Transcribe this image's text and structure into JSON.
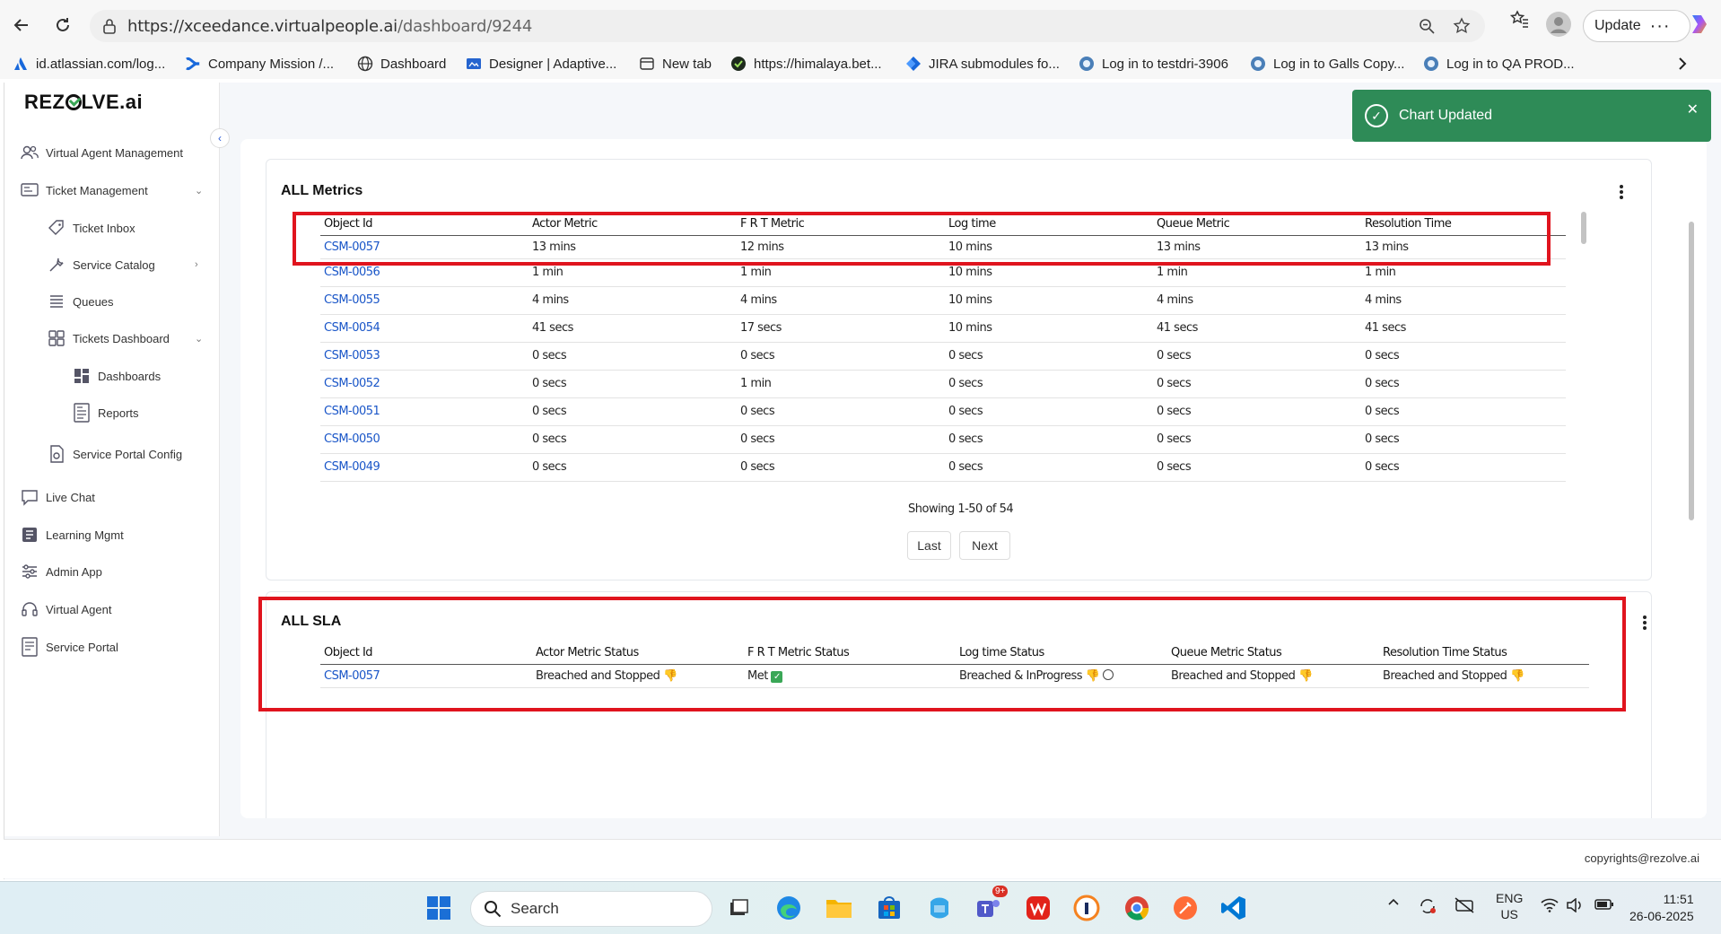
{
  "browser": {
    "url_main": "https://xceedance.virtualpeople.ai",
    "url_path": "/dashboard/9244",
    "update_label": "Update",
    "bookmarks": [
      {
        "label": "id.atlassian.com/log...",
        "icon": "atlassian-icon"
      },
      {
        "label": "Company Mission /...",
        "icon": "confluence-icon"
      },
      {
        "label": "Dashboard",
        "icon": "globe-icon"
      },
      {
        "label": "Designer | Adaptive...",
        "icon": "designer-icon"
      },
      {
        "label": "New tab",
        "icon": "newtab-icon"
      },
      {
        "label": "https://himalaya.bet...",
        "icon": "check-icon"
      },
      {
        "label": "JIRA submodules fo...",
        "icon": "jira-icon"
      },
      {
        "label": "Log in to testdri-3906",
        "icon": "login-icon"
      },
      {
        "label": "Log in to Galls Copy...",
        "icon": "login-icon"
      },
      {
        "label": "Log in to QA PROD...",
        "icon": "login-icon"
      }
    ]
  },
  "sidebar": {
    "logo_pre": "REZ",
    "logo_post": "LVE.ai",
    "items": {
      "virtual_agent_management": "Virtual Agent Management",
      "ticket_management": "Ticket Management",
      "ticket_inbox": "Ticket Inbox",
      "service_catalog": "Service Catalog",
      "queues": "Queues",
      "tickets_dashboard": "Tickets Dashboard",
      "dashboards": "Dashboards",
      "reports": "Reports",
      "service_portal_config": "Service Portal Config",
      "live_chat": "Live Chat",
      "learning_mgmt": "Learning Mgmt",
      "admin_app": "Admin App",
      "virtual_agent": "Virtual Agent",
      "service_portal": "Service Portal"
    }
  },
  "toast": {
    "message": "Chart Updated",
    "close": "✕"
  },
  "metrics": {
    "title": "ALL Metrics",
    "columns": [
      "Object Id",
      "Actor Metric",
      "F R T Metric",
      "Log time",
      "Queue Metric",
      "Resolution Time"
    ],
    "rows": [
      [
        "CSM-0057",
        "13 mins",
        "12 mins",
        "10 mins",
        "13 mins",
        "13 mins"
      ],
      [
        "CSM-0056",
        "1 min",
        "1 min",
        "10 mins",
        "1 min",
        "1 min"
      ],
      [
        "CSM-0055",
        "4 mins",
        "4 mins",
        "10 mins",
        "4 mins",
        "4 mins"
      ],
      [
        "CSM-0054",
        "41 secs",
        "17 secs",
        "10 mins",
        "41 secs",
        "41 secs"
      ],
      [
        "CSM-0053",
        "0 secs",
        "0 secs",
        "0 secs",
        "0 secs",
        "0 secs"
      ],
      [
        "CSM-0052",
        "0 secs",
        "1 min",
        "0 secs",
        "0 secs",
        "0 secs"
      ],
      [
        "CSM-0051",
        "0 secs",
        "0 secs",
        "0 secs",
        "0 secs",
        "0 secs"
      ],
      [
        "CSM-0050",
        "0 secs",
        "0 secs",
        "0 secs",
        "0 secs",
        "0 secs"
      ],
      [
        "CSM-0049",
        "0 secs",
        "0 secs",
        "0 secs",
        "0 secs",
        "0 secs"
      ]
    ],
    "pagination": {
      "info": "Showing 1-50 of 54",
      "last": "Last",
      "next": "Next"
    }
  },
  "sla": {
    "title": "ALL SLA",
    "columns": [
      "Object Id",
      "Actor Metric Status",
      "F R T Metric Status",
      "Log time Status",
      "Queue Metric Status",
      "Resolution Time Status"
    ],
    "rows": [
      {
        "id": "CSM-0057",
        "actor": "Breached and Stopped",
        "frt": "Met",
        "log": "Breached & InProgress",
        "queue": "Breached and Stopped",
        "resolution": "Breached and Stopped"
      }
    ]
  },
  "footer": {
    "copyright": "copyrights@rezolve.ai"
  },
  "taskbar": {
    "search_label": "Search",
    "teams_badge": "9+",
    "lang_line1": "ENG",
    "lang_line2": "US",
    "time": "11:51",
    "date": "26-06-2025"
  },
  "colors": {
    "accent": "#1a56c8",
    "toast": "#2e8b57",
    "highlight": "#e0141e"
  }
}
